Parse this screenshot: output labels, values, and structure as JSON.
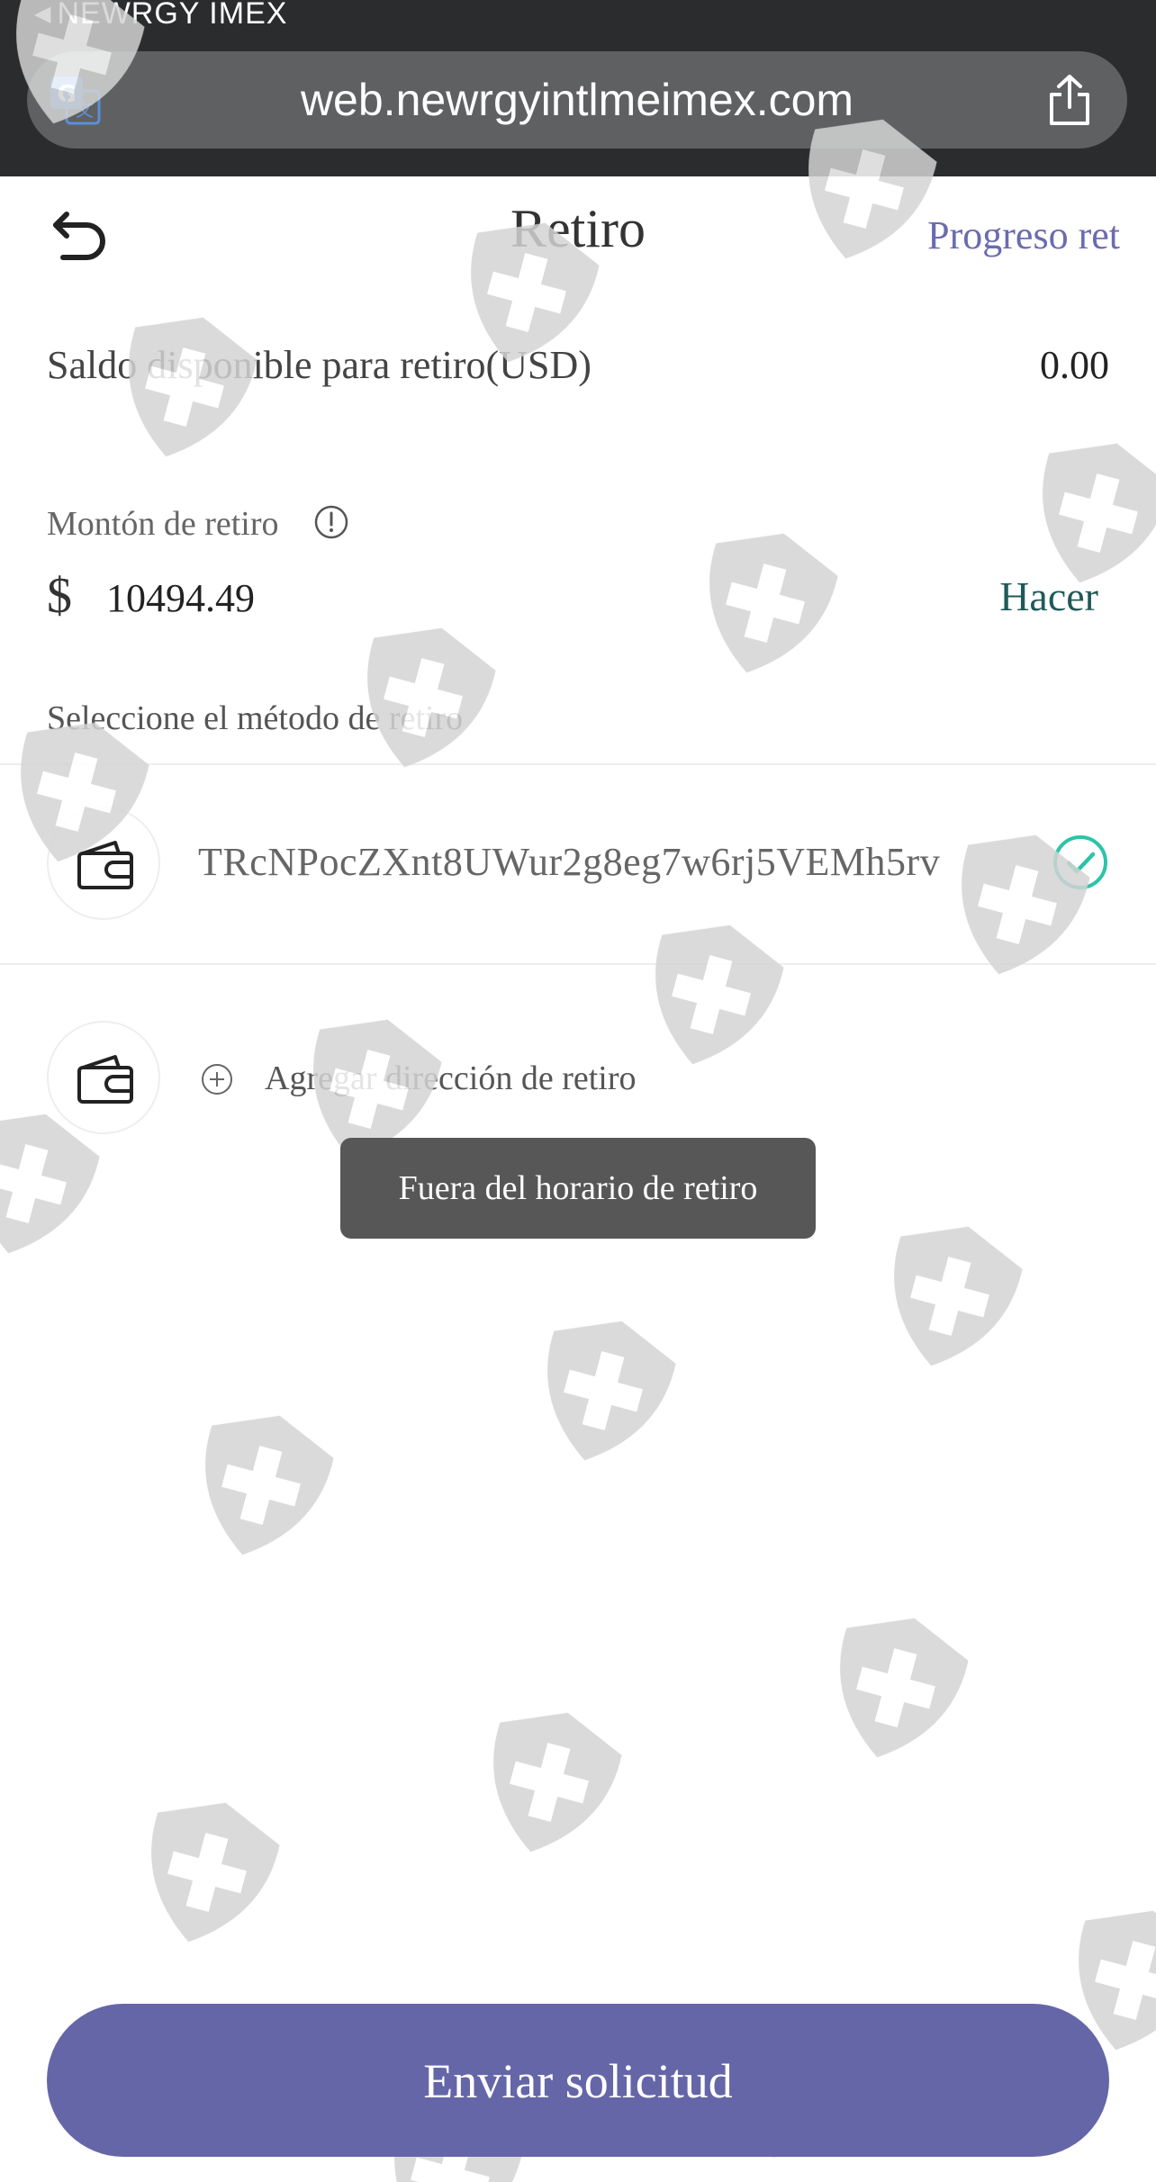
{
  "browser": {
    "back_app_label": "NEWRGY IMEX",
    "url": "web.newrgyintlmeimex.com"
  },
  "header": {
    "title": "Retiro",
    "progress_link": "Progreso ret"
  },
  "balance": {
    "label": "Saldo disponible para retiro(USD)",
    "value": "0.00"
  },
  "amount": {
    "label": "Montón de retiro",
    "currency": "$",
    "value": "10494.49",
    "action_label": "Hacer"
  },
  "method": {
    "label": "Seleccione el método de retiro",
    "selected_address": "TRcNPocZXnt8UWur2g8eg7w6rj5VEMh5rv",
    "add_label": "Agregar dirección de retiro"
  },
  "toast": {
    "message": "Fuera del horario de retiro"
  },
  "submit": {
    "label": "Enviar solicitud"
  },
  "colors": {
    "accent": "#6566a8",
    "link": "#6b6bb0",
    "action": "#1f5a58",
    "check": "#2bc4a8"
  },
  "icons": {
    "translate": "translate-icon",
    "share": "share-icon",
    "back": "back-arrow-icon",
    "info": "info-icon",
    "wallet": "wallet-icon",
    "check": "check-circle-icon",
    "plus": "plus-circle-icon",
    "watermark": "shield-cross-icon"
  }
}
